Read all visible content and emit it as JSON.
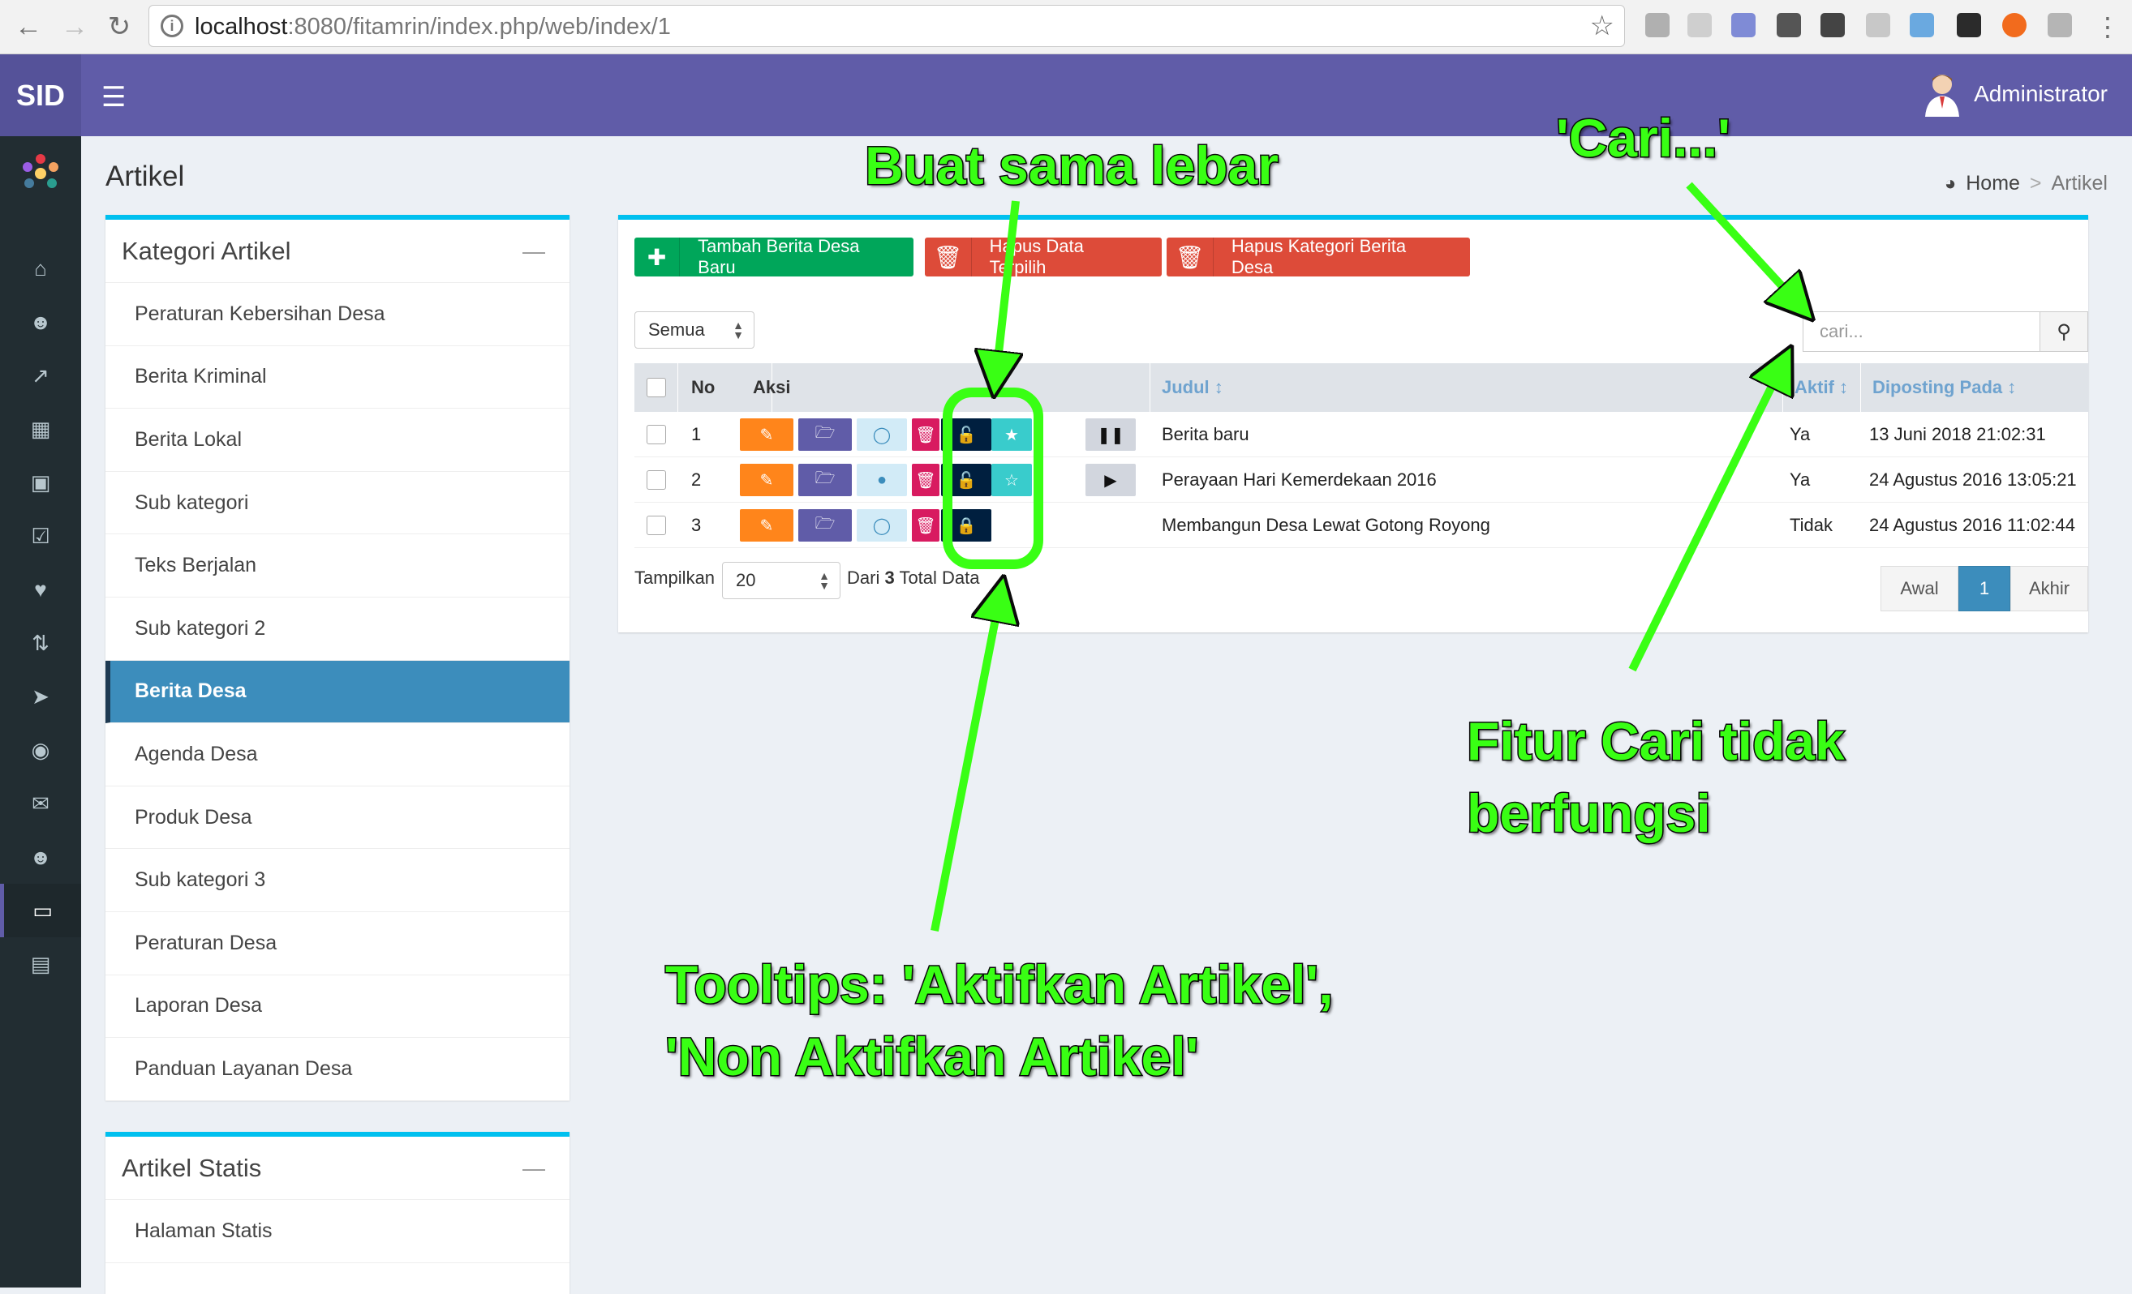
{
  "browser": {
    "url_host": "localhost",
    "url_path": ":8080/fitamrin/index.php/web/index/1"
  },
  "app": {
    "logo": "SID",
    "user_name": "Administrator"
  },
  "page": {
    "title": "Artikel",
    "breadcrumb": [
      "Home",
      "Artikel"
    ]
  },
  "categories": {
    "title": "Kategori Artikel",
    "items": [
      "Peraturan Kebersihan Desa",
      "Berita Kriminal",
      "Berita Lokal",
      "Sub kategori",
      "Teks Berjalan",
      "Sub kategori 2",
      "Berita Desa",
      "Agenda Desa",
      "Produk Desa",
      "Sub kategori 3",
      "Peraturan Desa",
      "Laporan Desa",
      "Panduan Layanan Desa"
    ],
    "active": "Berita Desa"
  },
  "static_articles": {
    "title": "Artikel Statis",
    "items": [
      "Halaman Statis"
    ]
  },
  "toolbar": {
    "add": "Tambah Berita Desa Baru",
    "delete_selected": "Hapus Data Terpilih",
    "delete_category": "Hapus Kategori Berita Desa"
  },
  "filter": {
    "status_selected": "Semua",
    "search_placeholder": "cari..."
  },
  "table": {
    "headers": {
      "no": "No",
      "aksi": "Aksi",
      "judul": "Judul",
      "aktif": "Aktif",
      "posted": "Diposting Pada"
    },
    "rows": [
      {
        "no": "1",
        "judul": "Berita baru",
        "aktif": "Ya",
        "posted": "13 Juni 2018 21:02:31"
      },
      {
        "no": "2",
        "judul": "Perayaan Hari Kemerdekaan 2016",
        "aktif": "Ya",
        "posted": "24 Agustus 2016 13:05:21"
      },
      {
        "no": "3",
        "judul": "Membangun Desa Lewat Gotong Royong",
        "aktif": "Tidak",
        "posted": "24 Agustus 2016 11:02:44"
      }
    ]
  },
  "footer": {
    "show_label": "Tampilkan",
    "per_page": "20",
    "from_label": "Dari",
    "total": "3",
    "total_label": "Total Data"
  },
  "pagination": {
    "first": "Awal",
    "current": "1",
    "last": "Akhir"
  },
  "annotations": {
    "same_width": "Buat sama lebar",
    "search_label": "'Cari...'",
    "search_broken_1": "Fitur Cari tidak",
    "search_broken_2": "berfungsi",
    "tooltips_1": "Tooltips: 'Aktifkan Artikel',",
    "tooltips_2": "'Non Aktifkan Artikel'"
  },
  "colors": {
    "header": "#605ca8",
    "annotation": "#39ff14",
    "active_item": "#3c8dbc"
  }
}
